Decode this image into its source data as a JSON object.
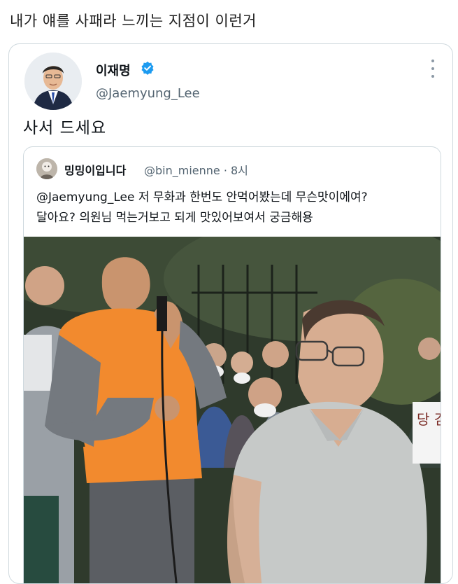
{
  "post": {
    "caption": "내가 얘를 사패라 느끼는 지점이 이런거"
  },
  "tweet": {
    "author": {
      "name": "이재명",
      "handle": "@Jaemyung_Lee"
    },
    "text": "사서 드세요"
  },
  "quoted_tweet": {
    "author": {
      "name": "밍밍이입니다",
      "handle": "@bin_mienne · 8시"
    },
    "text_line1": "@Jaemyung_Lee 저 무화과 한번도 안먹어봤는데 무슨맛이에여?",
    "text_line2": "달아요? 의원님 먹는거보고 되게 맛있어보여서 궁금해용",
    "sign_text": "당 검"
  },
  "icons": {
    "verified": "verified-badge-icon",
    "more": "more-options-icon"
  },
  "colors": {
    "verified": "#1d9bf0",
    "secondary_text": "#536471",
    "border": "#cfd9de",
    "orange_shirt": "#f28a2e"
  }
}
